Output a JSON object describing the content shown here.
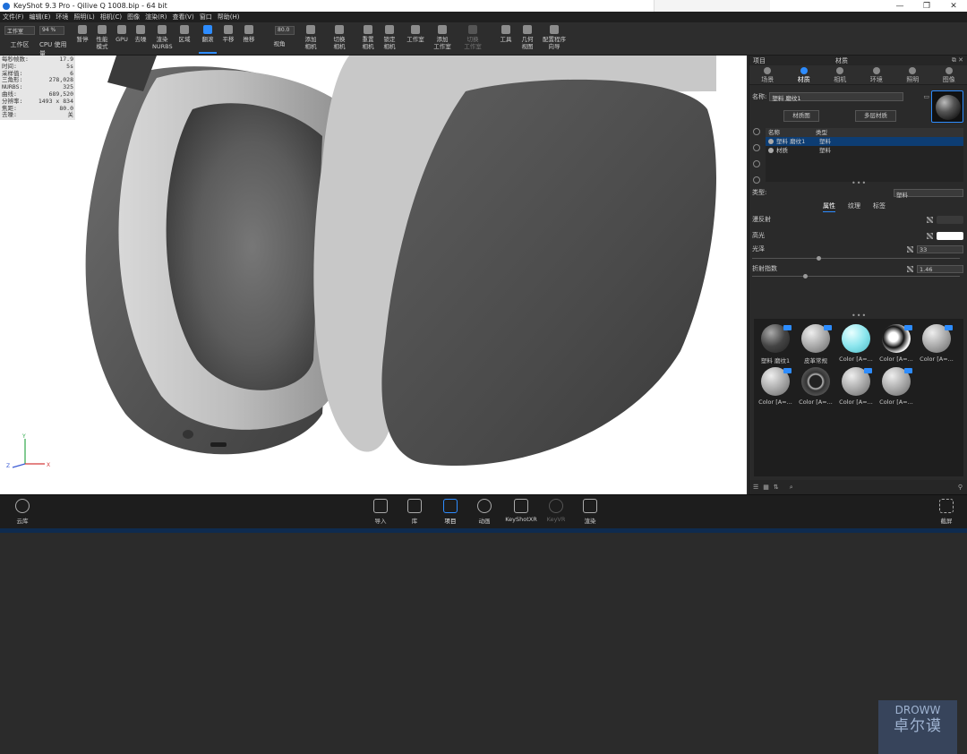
{
  "window": {
    "title": "KeyShot 9.3 Pro  - QiIive Q 1008.bip  - 64 bit",
    "controls": [
      "—",
      "❐",
      "✕"
    ]
  },
  "menu": [
    "文件(F)",
    "编辑(E)",
    "环境",
    "照明(L)",
    "相机(C)",
    "图像",
    "渲染(R)",
    "查看(V)",
    "窗口",
    "帮助(H)"
  ],
  "toolbar": {
    "workspace_value": "工作室",
    "workspace_label": "工作区",
    "cpu_value": "94 %",
    "cpu_label": "CPU 使用量",
    "fov_value": "80.0",
    "buttons": {
      "pause": "暂停",
      "performance_mode": [
        "性能",
        "模式"
      ],
      "gpu": "GPU",
      "denoise": "去噪",
      "render_nurbs": [
        "渲染",
        "NURBS"
      ],
      "region": "区域",
      "tumble": "翻滚",
      "pan": "平移",
      "dolly": "推移",
      "perspective": "视角",
      "add_camera": [
        "添加",
        "相机"
      ],
      "switch_camera": [
        "切换",
        "相机"
      ],
      "reset_camera": [
        "重置",
        "相机"
      ],
      "lock_camera": [
        "锁定",
        "相机"
      ],
      "studio": "工作室",
      "add_studio": [
        "添加",
        "工作室"
      ],
      "switch_studio": [
        "切换",
        "工作室"
      ],
      "tools": "工具",
      "geometry_view": [
        "几何",
        "视图"
      ],
      "configurator_wizard": [
        "配置程序",
        "向导"
      ]
    }
  },
  "hud": [
    {
      "k": "每秒帧数:",
      "v": "17.9"
    },
    {
      "k": "时间:",
      "v": "5s"
    },
    {
      "k": "采样值:",
      "v": "6"
    },
    {
      "k": "三角形:",
      "v": "278,028"
    },
    {
      "k": "NURBS:",
      "v": "325"
    },
    {
      "k": "曲线:",
      "v": "689,520"
    },
    {
      "k": "分辨率:",
      "v": "1493 x 834"
    },
    {
      "k": "焦距:",
      "v": "80.0"
    },
    {
      "k": "去噪:",
      "v": "关"
    }
  ],
  "axes": {
    "y": "Y",
    "x": "X",
    "z": "Z"
  },
  "panel": {
    "header_left": "项目",
    "header_title": "材质",
    "tabs": [
      "场景",
      "材质",
      "相机",
      "环境",
      "照明",
      "图像"
    ],
    "name_label": "名称:",
    "name_value": "塑料 磨纹1",
    "material_graph_button": "材质图",
    "multilayer_button": "多层材质",
    "table_headers": [
      "名称",
      "类型"
    ],
    "table_rows": [
      {
        "name": "塑料 磨纹1",
        "type": "塑料"
      },
      {
        "name": "材质",
        "type": "塑料"
      }
    ],
    "type_label": "类型:",
    "type_value": "塑料",
    "subtabs": [
      "属性",
      "纹理",
      "标签"
    ],
    "props": {
      "diffuse_label": "漫反射",
      "specular_label": "高光",
      "roughness_label": "光泽",
      "roughness_value": "33",
      "ior_label": "折射指数",
      "ior_value": "1.46"
    },
    "library": [
      {
        "label": "塑料 磨纹1"
      },
      {
        "label": "皮革常规"
      },
      {
        "label": "Color [A=..."
      },
      {
        "label": "Color [A=..."
      },
      {
        "label": "Color [A=..."
      },
      {
        "label": "Color [A=..."
      },
      {
        "label": "Color [A=..."
      },
      {
        "label": "Color [A=..."
      },
      {
        "label": "Color [A=..."
      }
    ],
    "watermark_top": "DROWW",
    "watermark_bottom": "卓尔谟"
  },
  "bottom": {
    "cloud": "云库",
    "import": "导入",
    "library": "库",
    "project": "项目",
    "animation": "动画",
    "keyshotxr": "KeyShotXR",
    "keyvr": "KeyVR",
    "render": "渲染",
    "screenshot": "截屏"
  },
  "colors": {
    "accent": "#2d8cff",
    "selection": "#0d3d73",
    "viewport_bg": "#ffffff",
    "panel_bg": "#2a2a2a"
  }
}
